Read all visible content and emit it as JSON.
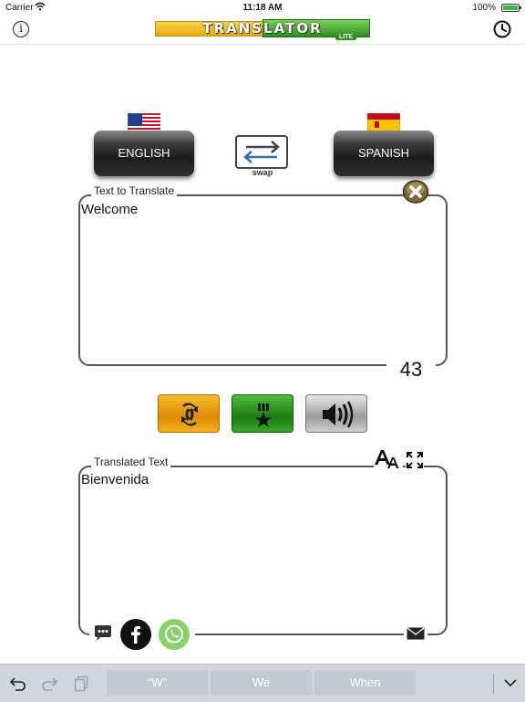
{
  "status_bar": {
    "carrier": "Carrier",
    "time": "11:18 AM",
    "battery": "100%"
  },
  "app": {
    "logo_text": "TRANSLATOR",
    "logo_badge": "LITE"
  },
  "languages": {
    "from": "ENGLISH",
    "to": "SPANISH",
    "swap_label": "swap"
  },
  "input": {
    "label": "Text to Translate",
    "text": "Welcome",
    "char_count": "43"
  },
  "output": {
    "label": "Translated Text",
    "text": "Bienvenida"
  },
  "keyboard": {
    "suggestions": [
      "“W”",
      "We",
      "When"
    ]
  },
  "icons": [
    "info-icon",
    "history-icon",
    "clear-icon",
    "translate-icon",
    "favorite-icon",
    "speaker-icon",
    "font-size-icon",
    "expand-icon",
    "sms-icon",
    "facebook-icon",
    "whatsapp-icon",
    "mail-icon",
    "undo-icon",
    "redo-icon",
    "paste-icon",
    "chevron-down-icon"
  ],
  "colors": {
    "translate_btn": "#e9a10f",
    "favorite_btn": "#2a8f1d",
    "speak_btn": "#b5b5b5",
    "facebook": "#111111",
    "whatsapp": "#8bd06a"
  }
}
